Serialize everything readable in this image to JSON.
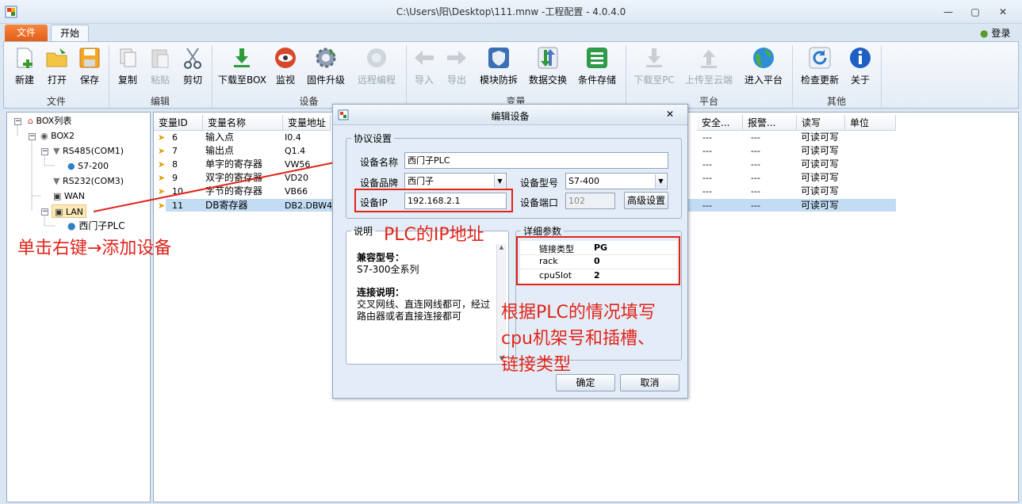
{
  "window": {
    "title": "C:\\Users\\阳\\Desktop\\111.mnw -工程配置 - 4.0.4.0",
    "minimize": "—",
    "maximize": "▢",
    "close": "✕"
  },
  "tabs": {
    "file": "文件",
    "home": "开始"
  },
  "login": "登录",
  "ribbon": {
    "buttons": [
      {
        "label": "新建",
        "icon": "new-file-icon"
      },
      {
        "label": "打开",
        "icon": "open-folder-icon"
      },
      {
        "label": "保存",
        "icon": "save-icon"
      },
      {
        "label": "复制",
        "icon": "copy-icon"
      },
      {
        "label": "粘贴",
        "icon": "paste-icon"
      },
      {
        "label": "剪切",
        "icon": "scissors-icon"
      },
      {
        "label": "下载至BOX",
        "icon": "download-icon"
      },
      {
        "label": "监视",
        "icon": "eye-icon"
      },
      {
        "label": "固件升级",
        "icon": "gear-icon"
      },
      {
        "label": "远程编程",
        "icon": "remote-icon"
      },
      {
        "label": "导入",
        "icon": "import-icon"
      },
      {
        "label": "导出",
        "icon": "export-icon"
      },
      {
        "label": "模块防拆",
        "icon": "shield-icon"
      },
      {
        "label": "数据交换",
        "icon": "exchange-icon"
      },
      {
        "label": "条件存储",
        "icon": "list-icon"
      },
      {
        "label": "下载至PC",
        "icon": "download-pc-icon"
      },
      {
        "label": "上传至云端",
        "icon": "upload-cloud-icon"
      },
      {
        "label": "进入平台",
        "icon": "globe-icon"
      },
      {
        "label": "检查更新",
        "icon": "refresh-icon"
      },
      {
        "label": "关于",
        "icon": "info-icon"
      }
    ],
    "groups": [
      "文件",
      "编辑",
      "设备",
      "变量",
      "平台",
      "其他"
    ]
  },
  "tree": {
    "root": "BOX列表",
    "box": "BOX2",
    "rs485": "RS485(COM1)",
    "s7200": "S7-200",
    "rs232": "RS232(COM3)",
    "wan": "WAN",
    "lan": "LAN",
    "plc": "西门子PLC"
  },
  "grid": {
    "headers": [
      "变量ID",
      "变量名称",
      "变量地址",
      "安全...",
      "报警...",
      "读写",
      "单位"
    ],
    "rows": [
      {
        "id": "6",
        "name": "输入点",
        "addr": "I0.4",
        "safe": "---",
        "alarm": "---",
        "rw": "可读可写"
      },
      {
        "id": "7",
        "name": "输出点",
        "addr": "Q1.4",
        "safe": "---",
        "alarm": "---",
        "rw": "可读可写"
      },
      {
        "id": "8",
        "name": "单字的寄存器",
        "addr": "VW56",
        "safe": "---",
        "alarm": "---",
        "rw": "可读可写"
      },
      {
        "id": "9",
        "name": "双字的寄存器",
        "addr": "VD20",
        "safe": "---",
        "alarm": "---",
        "rw": "可读可写"
      },
      {
        "id": "10",
        "name": "字节的寄存器",
        "addr": "VB66",
        "safe": "---",
        "alarm": "---",
        "rw": "可读可写"
      },
      {
        "id": "11",
        "name": "DB寄存器",
        "addr": "DB2.DBW4",
        "safe": "---",
        "alarm": "---",
        "rw": "可读可写"
      }
    ]
  },
  "dialog": {
    "title": "编辑设备",
    "close": "✕",
    "protocol_legend": "协议设置",
    "name_label": "设备名称",
    "name_value": "西门子PLC",
    "brand_label": "设备品牌",
    "brand_value": "西门子",
    "model_label": "设备型号",
    "model_value": "S7-400",
    "ip_label": "设备IP",
    "ip_value": "192.168.2.1",
    "port_label": "设备端口",
    "port_value": "102",
    "advanced": "高级设置",
    "desc_legend": "说明",
    "desc_h1": "兼容型号：",
    "desc_t1": "S7-300全系列",
    "desc_h2": "连接说明：",
    "desc_t2": "交叉网线、直连网线都可，经过路由器或者直接连接都可",
    "params_legend": "详细参数",
    "params": [
      {
        "key": "链接类型",
        "value": "PG"
      },
      {
        "key": "rack",
        "value": "0"
      },
      {
        "key": "cpuSlot",
        "value": "2"
      }
    ],
    "ok": "确定",
    "cancel": "取消"
  },
  "annotations": {
    "right_click": "单击右键→添加设备",
    "ip": "PLC的IP地址",
    "fill": "根据PLC的情况填写\ncpu机架号和插槽、\n链接类型"
  },
  "colors": {
    "annotation": "#e0241a",
    "file_tab": "#e8671f",
    "selection": "#c1dcf3"
  }
}
